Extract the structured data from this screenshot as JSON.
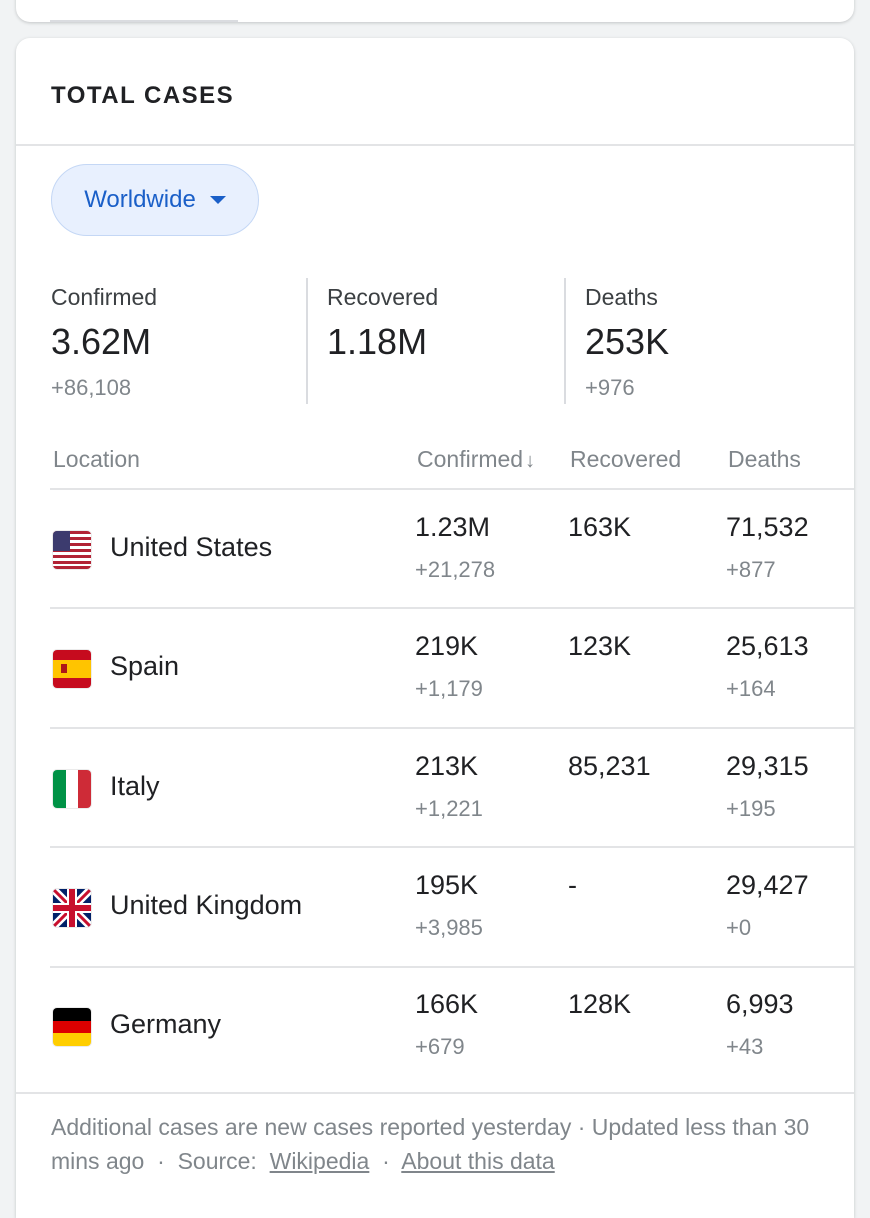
{
  "card": {
    "title": "TOTAL CASES",
    "region_selector": "Worldwide"
  },
  "summary": [
    {
      "label": "Confirmed",
      "value": "3.62M",
      "delta": "+86,108"
    },
    {
      "label": "Recovered",
      "value": "1.18M",
      "delta": ""
    },
    {
      "label": "Deaths",
      "value": "253K",
      "delta": "+976"
    }
  ],
  "table": {
    "headers": {
      "location": "Location",
      "confirmed": "Confirmed",
      "sort_arrow": "↓",
      "recovered": "Recovered",
      "deaths": "Deaths"
    },
    "rows": [
      {
        "country": "United States",
        "flag": "us-flag-icon",
        "confirmed": "1.23M",
        "confirmed_delta": "+21,278",
        "recovered": "163K",
        "deaths": "71,532",
        "deaths_delta": "+877"
      },
      {
        "country": "Spain",
        "flag": "spain-flag-icon",
        "confirmed": "219K",
        "confirmed_delta": "+1,179",
        "recovered": "123K",
        "deaths": "25,613",
        "deaths_delta": "+164"
      },
      {
        "country": "Italy",
        "flag": "italy-flag-icon",
        "confirmed": "213K",
        "confirmed_delta": "+1,221",
        "recovered": "85,231",
        "deaths": "29,315",
        "deaths_delta": "+195"
      },
      {
        "country": "United Kingdom",
        "flag": "uk-flag-icon",
        "confirmed": "195K",
        "confirmed_delta": "+3,985",
        "recovered": "-",
        "deaths": "29,427",
        "deaths_delta": "+0"
      },
      {
        "country": "Germany",
        "flag": "germany-flag-icon",
        "confirmed": "166K",
        "confirmed_delta": "+679",
        "recovered": "128K",
        "deaths": "6,993",
        "deaths_delta": "+43"
      }
    ]
  },
  "footer": {
    "note": "Additional cases are new cases reported yesterday · Updated less than 30 mins ago",
    "source_label": "Source:",
    "source_link": "Wikipedia",
    "about_link": "About this data"
  },
  "colors": {
    "accent": "#1a5fc8",
    "chip_bg": "#e8f0fe",
    "muted": "#80868b"
  }
}
